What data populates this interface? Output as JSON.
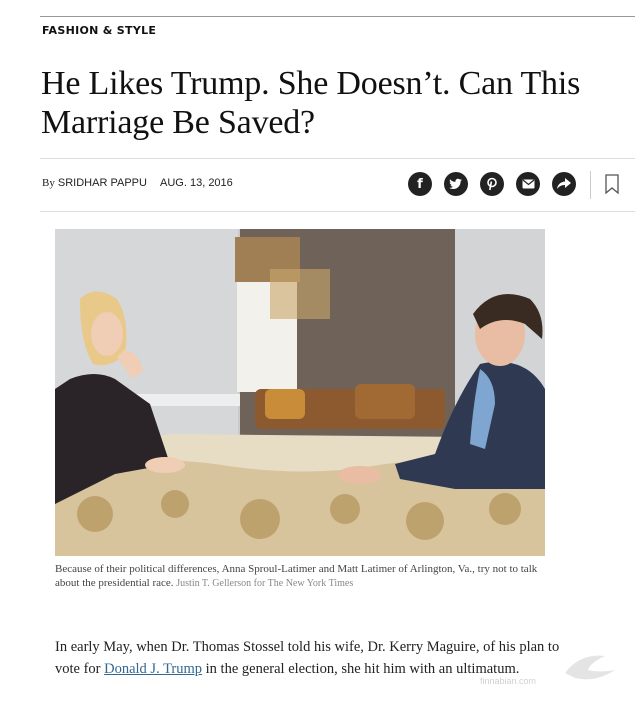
{
  "section": "FASHION & STYLE",
  "headline": "He Likes Trump. She Doesn’t. Can This Marriage Be Saved?",
  "byline": {
    "prefix": "By",
    "author": "SRIDHAR PAPPU",
    "date": "AUG. 13, 2016"
  },
  "share_icons": [
    "facebook-icon",
    "twitter-icon",
    "pinterest-icon",
    "email-icon",
    "share-icon"
  ],
  "caption": {
    "text": "Because of their political differences, Anna Sproul-Latimer and Matt Latimer of Arlington, Va., try not to talk about the presidential race.",
    "credit": "Justin T. Gellerson for The New York Times"
  },
  "article": {
    "before_link": "In early May, when Dr. Thomas Stossel told his wife, Dr. Kerry Maguire, of his plan to vote for ",
    "link": "Donald J. Trump",
    "after_link": " in the general election, she hit him with an ultimatum."
  },
  "watermark": {
    "text": "finnabian.com"
  },
  "colors": {
    "link": "#326891",
    "share_bg": "#222222"
  }
}
